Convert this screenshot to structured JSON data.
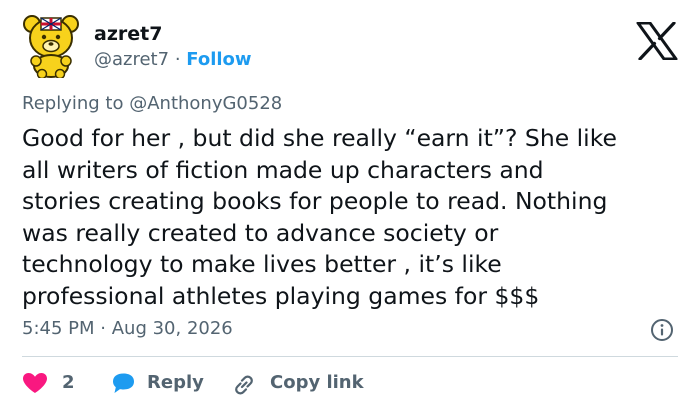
{
  "author": {
    "name": "azret7",
    "handle": "@azret7",
    "separator": "·",
    "follow_label": "Follow",
    "avatar_icon": "yellow-bear-with-flag-hat-avatar"
  },
  "reply_context": {
    "prefix": "Replying to",
    "mention": "@AnthonyG0528"
  },
  "tweet": {
    "text": "Good for her , but did she really “earn it”? She like\nall writers of fiction made up characters and\nstories creating books for people to read. Nothing\nwas really created to advance society or\ntechnology to make lives better , it’s like\nprofessional athletes playing games for $$$",
    "time": "5:45 PM",
    "separator": "·",
    "date": "Aug 30, 2026"
  },
  "actions": {
    "like_count": "2",
    "reply_label": "Reply",
    "copy_link_label": "Copy link"
  },
  "colors": {
    "text": "#0f1419",
    "secondary": "#536471",
    "accent": "#1d9bf0",
    "like": "#f91880",
    "divider": "#cfd9de"
  },
  "icons": {
    "brand": "x-logo-icon",
    "info": "info-icon",
    "like": "heart-icon",
    "reply": "speech-bubble-icon",
    "copy": "link-icon"
  }
}
